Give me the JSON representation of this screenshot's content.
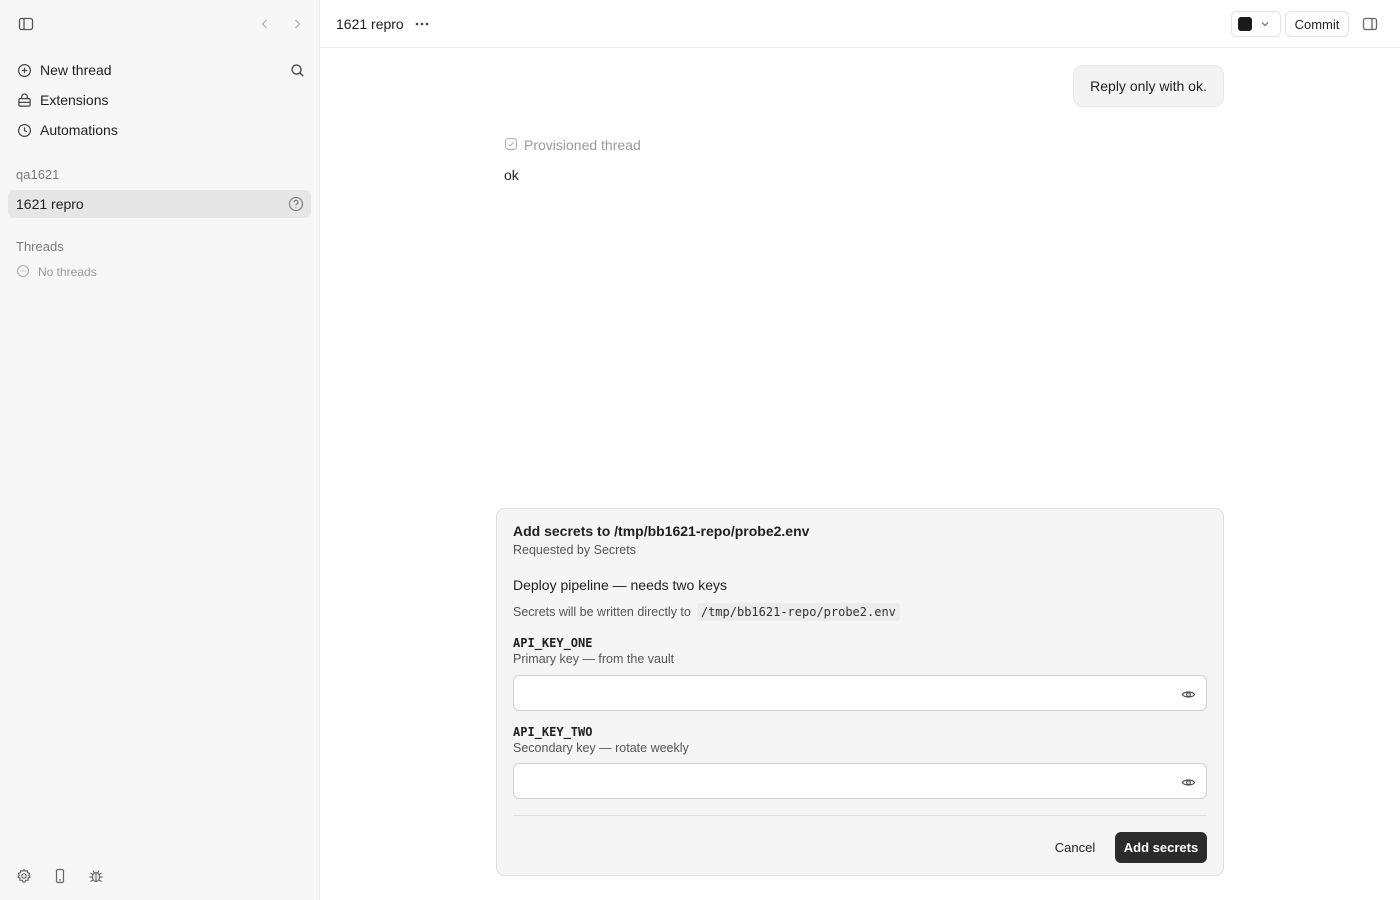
{
  "sidebar": {
    "nav": [
      {
        "label": "New thread",
        "icon": "plus-circle-icon"
      },
      {
        "label": "Extensions",
        "icon": "extensions-icon"
      },
      {
        "label": "Automations",
        "icon": "clock-icon"
      }
    ],
    "project_section_title": "qa1621",
    "project": {
      "label": "1621 repro"
    },
    "threads_section_title": "Threads",
    "empty_threads_label": "No threads"
  },
  "header": {
    "title": "1621 repro",
    "commit_label": "Commit"
  },
  "chat": {
    "user_message": "Reply only with ok.",
    "provisioned_label": "Provisioned thread",
    "assistant_reply": "ok"
  },
  "secrets_card": {
    "title": "Add secrets to /tmp/bb1621-repo/probe2.env",
    "requested_by": "Requested by Secrets",
    "heading": "Deploy pipeline — needs two keys",
    "description_prefix": "Secrets will be written directly to",
    "description_path": "/tmp/bb1621-repo/probe2.env",
    "keys": [
      {
        "name": "API_KEY_ONE",
        "help": "Primary key — from the vault",
        "value": ""
      },
      {
        "name": "API_KEY_TWO",
        "help": "Secondary key — rotate weekly",
        "value": ""
      }
    ],
    "cancel_label": "Cancel",
    "submit_label": "Add secrets"
  }
}
